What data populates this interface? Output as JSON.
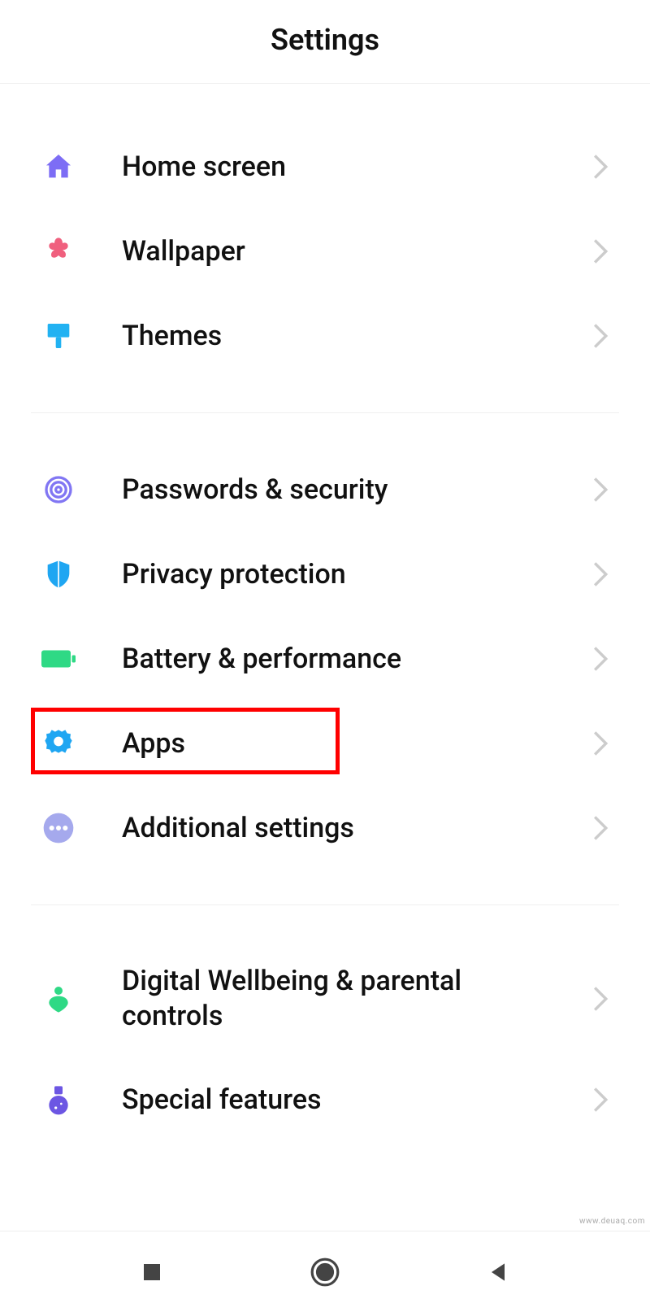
{
  "header": {
    "title": "Settings"
  },
  "groups": [
    {
      "items": [
        {
          "id": "home-screen",
          "label": "Home screen",
          "icon": "home-icon",
          "color": "#7d6df5"
        },
        {
          "id": "wallpaper",
          "label": "Wallpaper",
          "icon": "flower-icon",
          "color": "#f0607e"
        },
        {
          "id": "themes",
          "label": "Themes",
          "icon": "brush-icon",
          "color": "#22b2f2"
        }
      ]
    },
    {
      "items": [
        {
          "id": "passwords-security",
          "label": "Passwords & security",
          "icon": "fingerprint-icon",
          "color": "#8176f3"
        },
        {
          "id": "privacy-protection",
          "label": "Privacy protection",
          "icon": "shield-icon",
          "color": "#1fa6f2"
        },
        {
          "id": "battery-performance",
          "label": "Battery & performance",
          "icon": "battery-icon",
          "color": "#2fd985"
        },
        {
          "id": "apps",
          "label": "Apps",
          "icon": "gear-icon",
          "color": "#1fa6f2",
          "highlighted": true
        },
        {
          "id": "additional-settings",
          "label": "Additional settings",
          "icon": "dots-icon",
          "color": "#a5a9ed"
        }
      ]
    },
    {
      "items": [
        {
          "id": "digital-wellbeing",
          "label": "Digital Wellbeing & parental controls",
          "icon": "wellbeing-icon",
          "color": "#2fd985"
        },
        {
          "id": "special-features",
          "label": "Special features",
          "icon": "flask-icon",
          "color": "#6c56e3"
        }
      ]
    }
  ],
  "watermark": "www.deuaq.com"
}
